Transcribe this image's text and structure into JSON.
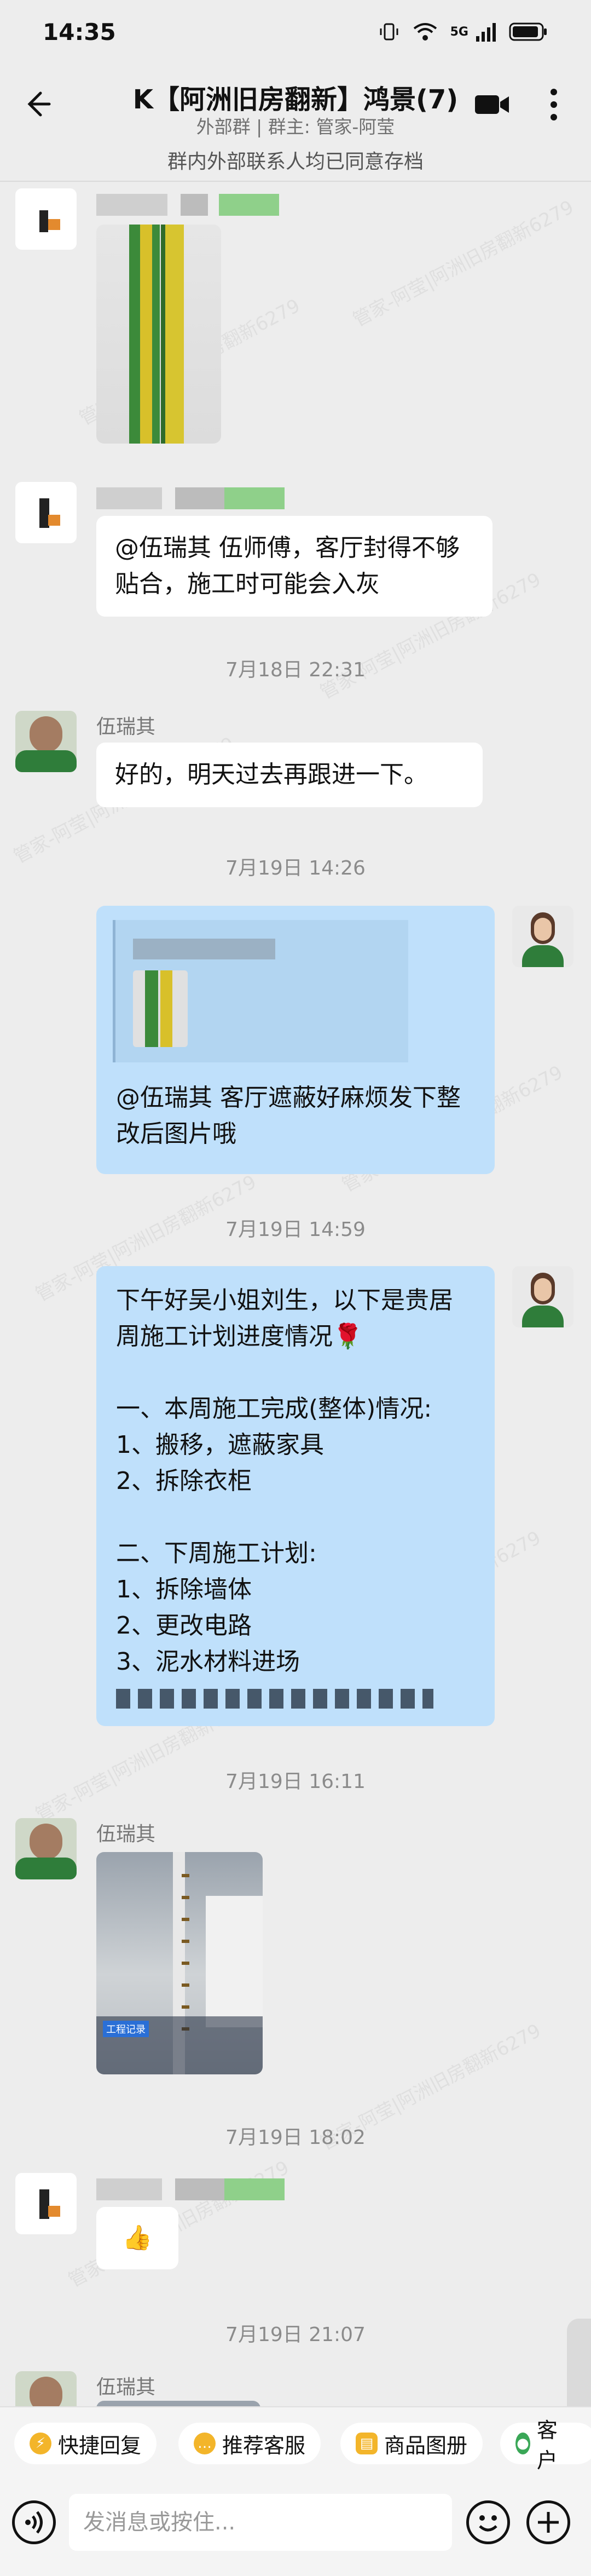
{
  "status": {
    "time": "14:35",
    "network": "5G"
  },
  "header": {
    "title": "K【阿洲旧房翻新】鸿景(7)",
    "subtitle": "外部群 | 群主: 管家-阿莹"
  },
  "notice": "群内外部联系人均已同意存档",
  "watermark": "管家-阿莹|阿洲旧房翻新6279",
  "messages": {
    "m2_text": "@伍瑞其 伍师傅，客厅封得不够贴合，施工时可能会入灰",
    "ts1": "7月18日 22:31",
    "m3_sender": "伍瑞其",
    "m3_text": "好的，明天过去再跟进一下。",
    "ts2": "7月19日 14:26",
    "m4_text": "@伍瑞其  客厅遮蔽好麻烦发下整改后图片哦",
    "ts3": "7月19日 14:59",
    "m5_lines": [
      "下午好吴小姐刘生，以下是贵居周施工计划进度情况🌹",
      "",
      "一、本周施工完成(整体)情况:",
      "1、搬移，遮蔽家具",
      "2、拆除衣柜",
      "",
      "二、下周施工计划:",
      "1、拆除墙体",
      "2、更改电路",
      "3、泥水材料进场"
    ],
    "ts4": "7月19日 16:11",
    "m6_sender": "伍瑞其",
    "m6_caption": "工程记录",
    "ts5": "7月19日 18:02",
    "m7_text": "👍",
    "ts6": "7月19日 21:07",
    "m8_sender": "伍瑞其"
  },
  "toolbar": {
    "quick_reply": "快捷回复",
    "recommend_service": "推荐客服",
    "product_album": "商品图册",
    "customer": "客户"
  },
  "input": {
    "placeholder": "发消息或按住..."
  },
  "colors": {
    "bubble_right": "#bfe0fb",
    "bubble_left": "#ffffff",
    "background": "#ededed"
  }
}
